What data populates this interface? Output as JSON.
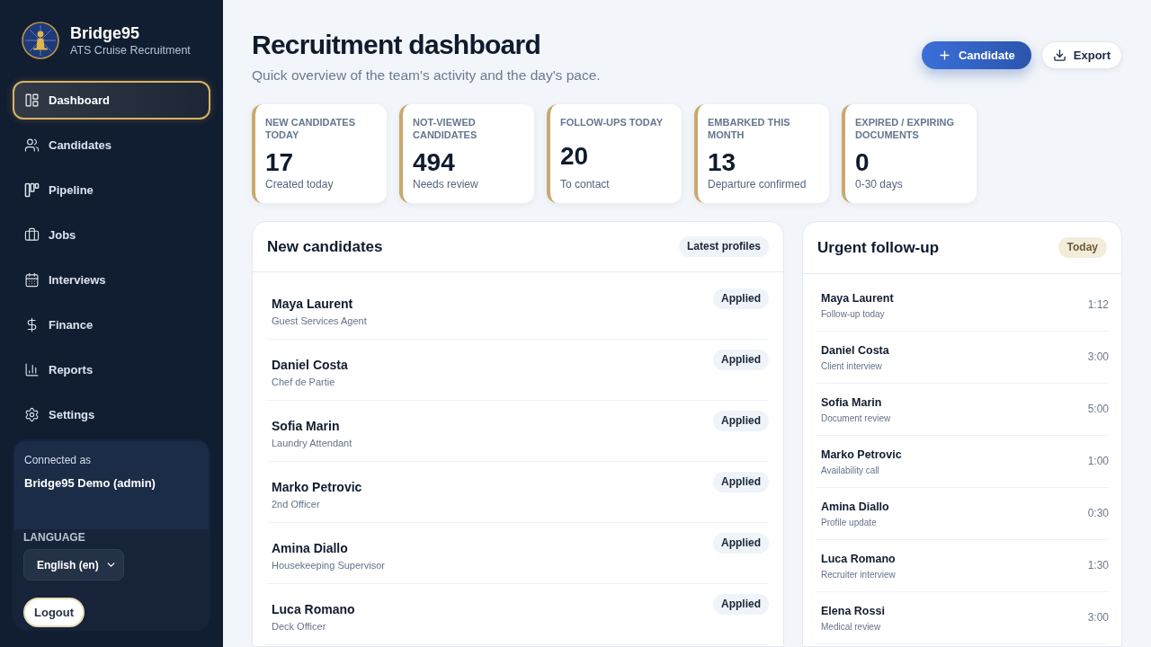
{
  "sidebar": {
    "brand": {
      "name": "Bridge95",
      "tagline": "ATS Cruise Recruitment"
    },
    "nav_items": [
      {
        "label": "Dashboard",
        "selected": true
      },
      {
        "label": "Candidates",
        "selected": false
      },
      {
        "label": "Pipeline",
        "selected": false
      },
      {
        "label": "Jobs",
        "selected": false
      },
      {
        "label": "Interviews",
        "selected": false
      },
      {
        "label": "Finance",
        "selected": false
      },
      {
        "label": "Reports",
        "selected": false
      },
      {
        "label": "Settings",
        "selected": false
      }
    ],
    "account": {
      "caption": "Connected as",
      "user": "Bridge95 Demo (admin)"
    },
    "language": {
      "label": "LANGUAGE",
      "value": "English (en)"
    },
    "logout": "Logout"
  },
  "header": {
    "title": "Recruitment dashboard",
    "subtitle": "Quick overview of the team's activity and the day's pace.",
    "actions": [
      {
        "label": "Candidate",
        "kind": "primary"
      },
      {
        "label": "Export",
        "kind": "secondary"
      }
    ]
  },
  "stats": [
    {
      "label": "NEW CANDIDATES TODAY",
      "value": "17",
      "caption": "Created today"
    },
    {
      "label": "NOT-VIEWED CANDIDATES",
      "value": "494",
      "caption": "Needs review"
    },
    {
      "label": "FOLLOW-UPS TODAY",
      "value": "20",
      "caption": "To contact"
    },
    {
      "label": "EMBARKED THIS MONTH",
      "value": "13",
      "caption": "Departure confirmed"
    },
    {
      "label": "EXPIRED / EXPIRING DOCUMENTS",
      "value": "0",
      "caption": "0-30 days"
    }
  ],
  "new_candidates": {
    "title": "New candidates",
    "badge": "Latest profiles",
    "rows": [
      {
        "name": "Maya Laurent",
        "role": "Guest Services Agent",
        "status": "Applied"
      },
      {
        "name": "Daniel Costa",
        "role": "Chef de Partie",
        "status": "Applied"
      },
      {
        "name": "Sofia Marin",
        "role": "Laundry Attendant",
        "status": "Applied"
      },
      {
        "name": "Marko Petrovic",
        "role": "2nd Officer",
        "status": "Applied"
      },
      {
        "name": "Amina Diallo",
        "role": "Housekeeping Supervisor",
        "status": "Applied"
      },
      {
        "name": "Luca Romano",
        "role": "Deck Officer",
        "status": "Applied"
      }
    ]
  },
  "urgent_follow_up": {
    "title": "Urgent follow-up",
    "badge": "Today",
    "rows": [
      {
        "name": "Maya Laurent",
        "task": "Follow-up today",
        "time": "1:12"
      },
      {
        "name": "Daniel Costa",
        "task": "Client interview",
        "time": "3:00"
      },
      {
        "name": "Sofia Marin",
        "task": "Document review",
        "time": "5:00"
      },
      {
        "name": "Marko Petrovic",
        "task": "Availability call",
        "time": "1:00"
      },
      {
        "name": "Amina Diallo",
        "task": "Profile update",
        "time": "0:30"
      },
      {
        "name": "Luca Romano",
        "task": "Recruiter interview",
        "time": "1:30"
      },
      {
        "name": "Elena Rossi",
        "task": "Medical review",
        "time": "3:00"
      }
    ]
  }
}
